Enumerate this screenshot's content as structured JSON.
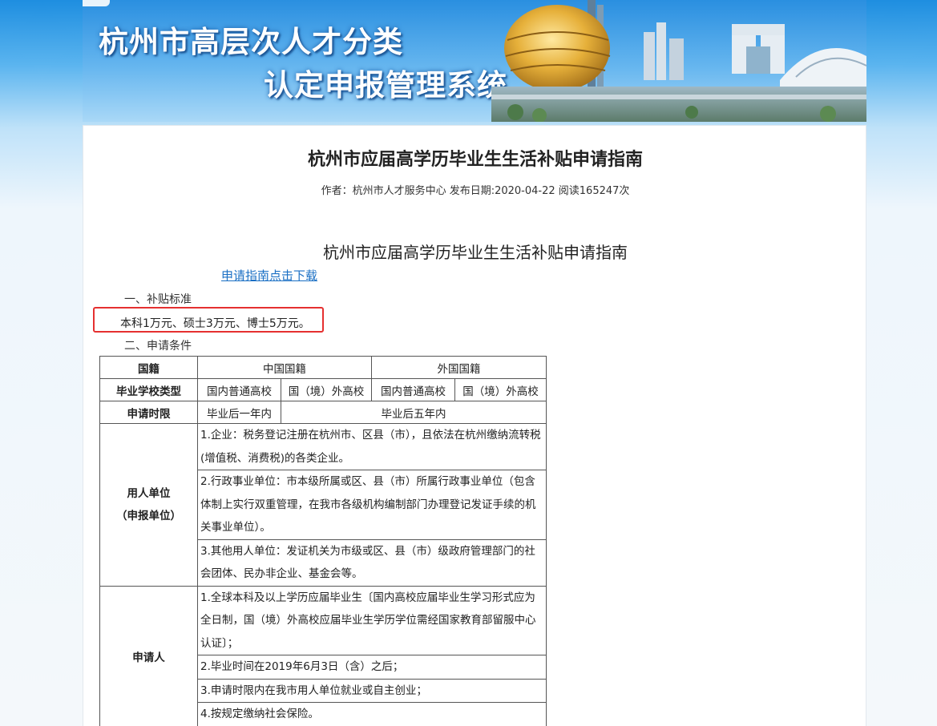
{
  "banner": {
    "line1": "杭州市高层次人才分类",
    "line2": "认定申报管理系统"
  },
  "article": {
    "title": "杭州市应届高学历毕业生生活补贴申请指南",
    "meta": "作者：杭州市人才服务中心 发布日期:2020-04-22 阅读165247次",
    "subtitle": "杭州市应届高学历毕业生生活补贴申请指南",
    "download_link": "申请指南点击下载",
    "section1": "一、补贴标准",
    "standard": "本科1万元、硕士3万元、博士5万元。",
    "section2": "二、申请条件"
  },
  "table": {
    "r1": {
      "label": "国籍",
      "cn": "中国国籍",
      "foreign": "外国国籍"
    },
    "r2": {
      "label": "毕业学校类型",
      "a": "国内普通高校",
      "b": "国（境）外高校",
      "c": "国内普通高校",
      "d": "国（境）外高校"
    },
    "r3": {
      "label": "申请时限",
      "a": "毕业后一年内",
      "b": "毕业后五年内"
    },
    "employer": {
      "label1": "用人单位",
      "label2": "（申报单位）",
      "items": [
        "1.企业：税务登记注册在杭州市、区县（市），且依法在杭州缴纳流转税(增值税、消费税)的各类企业。",
        "2.行政事业单位：市本级所属或区、县（市）所属行政事业单位（包含体制上实行双重管理，在我市各级机构编制部门办理登记发证手续的机关事业单位）。",
        "3.其他用人单位：发证机关为市级或区、县（市）级政府管理部门的社会团体、民办非企业、基金会等。"
      ]
    },
    "applicant": {
      "label": "申请人",
      "items": [
        "1.全球本科及以上学历应届毕业生〔国内高校应届毕业生学习形式应为全日制，国（境）外高校应届毕业生学历学位需经国家教育部留服中心认证〕；",
        "2.毕业时间在2019年6月3日（含）之后；",
        "3.申请时限内在我市用人单位就业或自主创业；",
        "4.按规定缴纳社会保险。"
      ]
    }
  },
  "colors": {
    "link": "#1a6fc4",
    "highlight_border": "#e53030",
    "banner_sky": "#2a8fe0"
  }
}
